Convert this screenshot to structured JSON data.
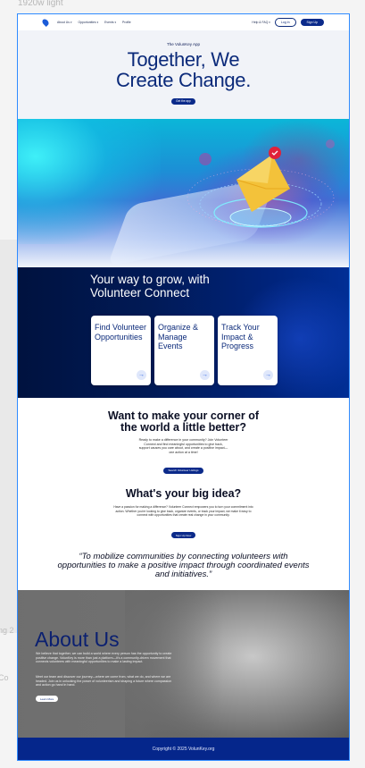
{
  "canvas": {
    "frame_label": "1920w light",
    "side_label_a": "ng 2",
    "side_label_b": "Co"
  },
  "nav": {
    "links": [
      {
        "label": "About Us",
        "has_menu": true
      },
      {
        "label": "Opportunities",
        "has_menu": true
      },
      {
        "label": "Events",
        "has_menu": true
      },
      {
        "label": "Profile",
        "has_menu": false
      }
    ],
    "help_label": "Help & FAQ",
    "login_label": "Log In",
    "signup_label": "Sign Up"
  },
  "hero": {
    "eyebrow": "The VolunKey App",
    "title": "Together, We Create Change.",
    "cta_label": "Get the app"
  },
  "connect": {
    "title": "Your way to grow, with Volunteer Connect",
    "cards": [
      {
        "title": "Find Volunteer Opportunities"
      },
      {
        "title": "Organize & Manage Events"
      },
      {
        "title": "Track Your Impact & Progress"
      }
    ]
  },
  "corner": {
    "title": "Want to make your corner of the world a little better?",
    "body": "Ready to make a difference in your community? Join Volunteer Connect and find meaningful opportunities to give back, support causes you care about, and create a positive impact—one action at a time!",
    "cta_label": "Search Volunteer Listings"
  },
  "idea": {
    "title": "What's your big idea?",
    "body": "Have a passion for making a difference? Volunteer Connect empowers you to turn your commitment into action. Whether you're looking to give back, organize events, or track your impact, we make it easy to connect with opportunities that create real change in your community.",
    "cta_label": "Sign Up Now"
  },
  "mission": {
    "quote": "“To mobilize communities by connecting volunteers with opportunities to make a positive impact through coordinated events and initiatives.”"
  },
  "about": {
    "title": "About Us",
    "p1": "We believe that together, we can build a world where every person has the opportunity to create positive change. VolunKey is more than just a platform—it's a community-driven movement that connects volunteers with meaningful opportunities to make a lasting impact.",
    "p2": "Meet our team and discover our journey—where we come from, what we do, and where we are headed. Join us in unlocking the power of volunteerism and shaping a future where compassion and action go hand in hand.",
    "cta_label": "Learn More"
  },
  "footer": {
    "copyright": "Copyright © 2025 VolunKey.org"
  },
  "colors": {
    "primary": "#0b2a8a",
    "heading": "#0b2a7a",
    "frame_outline": "#2f8bff",
    "footer_bg": "#05268b"
  }
}
